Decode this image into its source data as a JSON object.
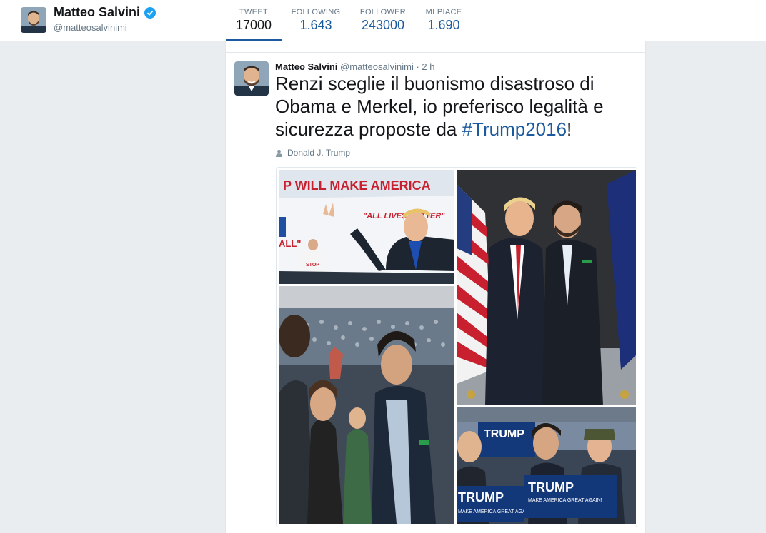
{
  "profile": {
    "name": "Matteo Salvini",
    "handle": "@matteosalvinimi"
  },
  "stats": [
    {
      "label": "TWEET",
      "value": "17000"
    },
    {
      "label": "FOLLOWING",
      "value": "1.643"
    },
    {
      "label": "FOLLOWER",
      "value": "243000"
    },
    {
      "label": "MI PIACE",
      "value": "1.690"
    }
  ],
  "tweet": {
    "author": "Matteo Salvini",
    "handle": "@matteosalvinimi",
    "separator": " · ",
    "time": "2 h",
    "text_before": "Renzi sceglie il buonismo disastroso di Obama e Merkel, io preferisco legalità e sicurezza proposte da ",
    "hashtag": "#Trump2016",
    "text_after": "!",
    "tagged_user": "Donald J. Trump"
  },
  "media": {
    "billboard_top": "P WILL MAKE AMERICA",
    "billboard_quote": "\"ALL LIVES MATTER\"",
    "billboard_left": "ALL\"",
    "shirt_text": "STOP",
    "sign_1": "TRUMP",
    "sign_2": "TRUMP",
    "sign_3": "TRUMP",
    "sign_subtext": "MAKE AMERICA GREAT AGAIN!"
  },
  "colors": {
    "accent": "#1b5a9e",
    "verified": "#1da1f2",
    "muted": "#657786"
  }
}
